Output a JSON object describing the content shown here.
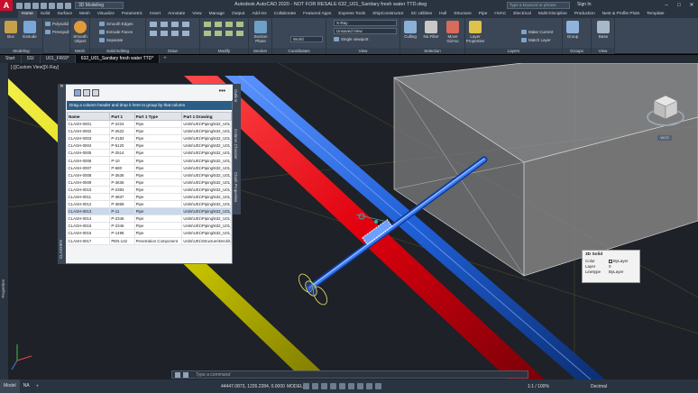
{
  "app": {
    "logo": "A",
    "title": "Autodesk AutoCAD 2020 - NOT FOR RESALE   632_U01_Sanitary fresh water TTD.dwg",
    "workspace": "3D Modeling",
    "search_placeholder": "Type a keyword or phrase",
    "sign_in": "Sign In",
    "window_controls": [
      "–",
      "□",
      "✕"
    ]
  },
  "ribbon_tabs": [
    "Home",
    "Solid",
    "Surface",
    "Mesh",
    "Visualize",
    "Parametric",
    "Insert",
    "Annotate",
    "View",
    "Manage",
    "Output",
    "Add-ins",
    "Collaborate",
    "Featured Apps",
    "Express Tools",
    "ShipConstructor",
    "SC Utilities",
    "Hull",
    "Structure",
    "Pipe",
    "HVAC",
    "Electrical",
    "Multi Discipline",
    "Production",
    "Nest & Profile Plots",
    "Template"
  ],
  "active_tab": "Home",
  "ribbon": {
    "modeling": {
      "title": "Modeling",
      "box": "Box",
      "extrude": "Extrude",
      "polysolid": "Polysolid",
      "presspull": "Presspull"
    },
    "mesh": {
      "title": "Mesh",
      "smooth": "Smooth Object"
    },
    "solid_editing": {
      "title": "Solid Editing",
      "smooth_edges": "Smooth Edges",
      "extrude_faces": "Extrude Faces",
      "separate": "Separate"
    },
    "draw": {
      "title": "Draw"
    },
    "modify": {
      "title": "Modify"
    },
    "section": {
      "title": "Section",
      "section_plane": "Section Plane"
    },
    "coordinates": {
      "title": "Coordinates",
      "world": "World"
    },
    "view": {
      "title": "View",
      "visual_style": "X-Ray",
      "saved_view": "Unsaved View",
      "viewport": "Single viewport"
    },
    "selection": {
      "title": "Selection",
      "culling": "Culling",
      "no_filter": "No Filter",
      "move_gizmo": "Move Gizmo"
    },
    "layers": {
      "title": "Layers",
      "layer_properties": "Layer Properties",
      "make_current": "Make Current",
      "match_layer": "Match Layer"
    },
    "groups": {
      "title": "Groups",
      "group": "Group"
    },
    "view2": {
      "title": "View",
      "base": "Base"
    }
  },
  "doc_tabs": [
    "Start",
    "SSI",
    "U01_FR69*",
    "632_U01_Sanitary fresh water TTD*"
  ],
  "viewport_label": "[-][Custom View][X-Ray]",
  "side_labels": {
    "properties": "Properties",
    "clashes": "CLASHES",
    "outline": "Outline",
    "column_chooser": "Column Chooser",
    "clash_properties": "Clash Properties"
  },
  "clash_palette": {
    "group_hint": "Drag a column header and drop it here to group by that column",
    "more": "•••",
    "columns": [
      "Name",
      "Part 1",
      "Part 1 Type",
      "Part 1 Drawing"
    ],
    "rows": [
      [
        "CLASH-0001",
        "P-2224",
        "Pipe",
        "Units\\U01\\Piping\\632_U01_Sanit"
      ],
      [
        "CLASH-0002",
        "P-2622",
        "Pipe",
        "Units\\U01\\Piping\\632_U01_Sanit"
      ],
      [
        "CLASH-0003",
        "P-2183",
        "Pipe",
        "Units\\U01\\Piping\\632_U01_Sanit"
      ],
      [
        "CLASH-0004",
        "P-5120",
        "Pipe",
        "Units\\U01\\Piping\\632_U01_Sanit"
      ],
      [
        "CLASH-0005",
        "P-2514",
        "Pipe",
        "Units\\U01\\Piping\\632_U01_Sanit"
      ],
      [
        "CLASH-0006",
        "P-10",
        "Pipe",
        "Units\\U01\\Piping\\632_U01_Sanit"
      ],
      [
        "CLASH-0007",
        "P-680",
        "Pipe",
        "Units\\U01\\Piping\\632_U01_Sanit"
      ],
      [
        "CLASH-0008",
        "P-3636",
        "Pipe",
        "Units\\U01\\Piping\\632_U01_Sanit"
      ],
      [
        "CLASH-0009",
        "P-3636",
        "Pipe",
        "Units\\U01\\Piping\\632_U01_Sanit"
      ],
      [
        "CLASH-0010",
        "P-2383",
        "Pipe",
        "Units\\U01\\Piping\\632_U01_Sanit"
      ],
      [
        "CLASH-0011",
        "P-3837",
        "Pipe",
        "Units\\U01\\Piping\\632_U01_Sanit"
      ],
      [
        "CLASH-0012",
        "P-3868",
        "Pipe",
        "Units\\U01\\Piping\\632_U01_Sanit"
      ],
      [
        "CLASH-0013",
        "P-11",
        "Pipe",
        "Units\\U01\\Piping\\632_U01_Sanit"
      ],
      [
        "CLASH-0014",
        "P-2346",
        "Pipe",
        "Units\\U01\\Piping\\632_U01_Sanit"
      ],
      [
        "CLASH-0015",
        "P-2346",
        "Pipe",
        "Units\\U01\\Piping\\632_U01_Sanit"
      ],
      [
        "CLASH-0016",
        "P-1498",
        "Pipe",
        "Units\\U01\\Piping\\632_U01_Sanit"
      ],
      [
        "CLASH-0017",
        "PEN-142",
        "Penetration Component",
        "Units\\U01\\Structure\\Deck\\U01_F"
      ]
    ],
    "selected_row": 12
  },
  "viewcube": {
    "top_label": "N",
    "wcs": "WCS"
  },
  "tooltip": {
    "title": "3D Solid",
    "rows": [
      {
        "k": "Color",
        "v": "ByLayer",
        "swatch": true
      },
      {
        "k": "Layer",
        "v": "0"
      },
      {
        "k": "Linetype",
        "v": "ByLayer"
      }
    ]
  },
  "command": {
    "placeholder": "Type a command"
  },
  "status": {
    "tabs": [
      "Model",
      "NA"
    ],
    "coords": "44447.0873, 1226.2284, 0.0000",
    "model": "MODEL",
    "scale": "1:1 / 100%",
    "units": "Decimal"
  },
  "colors": {
    "pipe_yellow": "#d8d400",
    "pipe_red": "#e0000e",
    "pipe_blue": "#1f5fd6",
    "branch_blue": "#2a6fe8",
    "box_gray": "#8d8d8d"
  }
}
